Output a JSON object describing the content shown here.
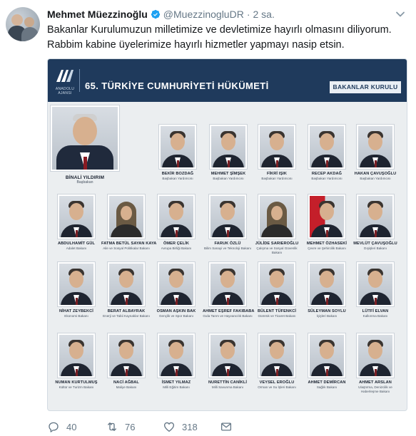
{
  "tweet": {
    "author_name": "Mehmet Müezzinoğlu",
    "handle": "@MuezzinogluDR",
    "separator": "·",
    "time": "2 sa.",
    "text_lines": [
      "Bakanlar Kurulumuzun milletimize ve devletimize hayırlı olmasını diliyorum.",
      "Rabbim kabine üyelerimize hayırlı hizmetler yapmayı nasip etsin."
    ]
  },
  "infographic": {
    "logo_caption": "ANADOLU AJANSI",
    "title": "65. TÜRKİYE CUMHURİYETİ HÜKÜMETİ",
    "badge": "BAKANLAR KURULU",
    "members": [
      {
        "name": "BİNALİ YILDIRIM",
        "role": "Başbakan"
      },
      {
        "name": "BEKİR BOZDAĞ",
        "role": "Başbakan Yardımcısı"
      },
      {
        "name": "MEHMET ŞİMŞEK",
        "role": "Başbakan Yardımcısı"
      },
      {
        "name": "FİKRİ IŞIK",
        "role": "Başbakan Yardımcısı"
      },
      {
        "name": "RECEP AKDAĞ",
        "role": "Başbakan Yardımcısı"
      },
      {
        "name": "HAKAN ÇAVUŞOĞLU",
        "role": "Başbakan Yardımcısı"
      },
      {
        "name": "ABDULHAMİT GÜL",
        "role": "Adalet Bakanı"
      },
      {
        "name": "FATMA BETÜL SAYAN KAYA",
        "role": "Aile ve Sosyal Politikalar Bakanı"
      },
      {
        "name": "ÖMER ÇELİK",
        "role": "Avrupa Birliği Bakanı"
      },
      {
        "name": "FARUK ÖZLÜ",
        "role": "Bilim Sanayi ve Teknoloji Bakanı"
      },
      {
        "name": "JÜLİDE SARIEROĞLU",
        "role": "Çalışma ve Sosyal Güvenlik Bakanı"
      },
      {
        "name": "MEHMET ÖZHASEKİ",
        "role": "Çevre ve Şehircilik Bakanı"
      },
      {
        "name": "MEVLÜT ÇAVUŞOĞLU",
        "role": "Dışişleri Bakanı"
      },
      {
        "name": "NİHAT ZEYBEKCİ",
        "role": "Ekonomi Bakanı"
      },
      {
        "name": "BERAT ALBAYRAK",
        "role": "Enerji ve Tabii Kaynaklar Bakanı"
      },
      {
        "name": "OSMAN AŞKIN BAK",
        "role": "Gençlik ve Spor Bakanı"
      },
      {
        "name": "AHMET EŞREF FAKIBABA",
        "role": "Gıda Tarım ve Hayvancılık Bakanı"
      },
      {
        "name": "BÜLENT TÜFENKCİ",
        "role": "Gümrük ve Ticaret Bakanı"
      },
      {
        "name": "SÜLEYMAN SOYLU",
        "role": "İçişleri Bakanı"
      },
      {
        "name": "LÜTFİ ELVAN",
        "role": "Kalkınma Bakanı"
      },
      {
        "name": "NUMAN KURTULMUŞ",
        "role": "Kültür ve Turizm Bakanı"
      },
      {
        "name": "NACİ AĞBAL",
        "role": "Maliye Bakanı"
      },
      {
        "name": "İSMET YILMAZ",
        "role": "Milli Eğitim Bakanı"
      },
      {
        "name": "NURETTİN CANİKLİ",
        "role": "Milli Savunma Bakanı"
      },
      {
        "name": "VEYSEL EROĞLU",
        "role": "Orman ve Su İşleri Bakanı"
      },
      {
        "name": "AHMET DEMİRCAN",
        "role": "Sağlık Bakanı"
      },
      {
        "name": "AHMET ARSLAN",
        "role": "Ulaştırma, Denizcilik ve Haberleşme Bakanı"
      }
    ]
  },
  "actions": {
    "reply_count": "40",
    "retweet_count": "76",
    "like_count": "318"
  },
  "icons": {
    "verified": "verified-badge-icon",
    "caret": "chevron-down-icon",
    "reply": "reply-icon",
    "retweet": "retweet-icon",
    "like": "heart-icon",
    "dm": "envelope-icon"
  },
  "colors": {
    "accent": "#1da1f2",
    "muted": "#657786",
    "banner": "#1f3a5c"
  }
}
